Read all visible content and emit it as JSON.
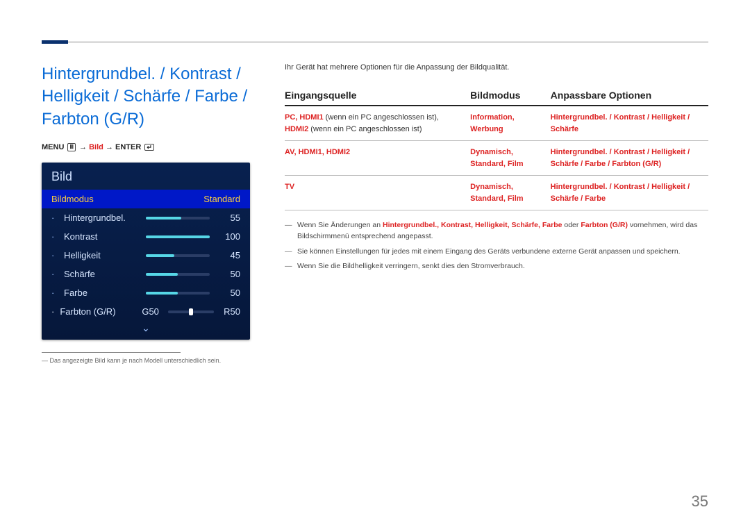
{
  "page_number": "35",
  "title": "Hintergrundbel. / Kontrast / Helligkeit / Schärfe / Farbe / Farbton (G/R)",
  "menupath": {
    "menu_label": "MENU",
    "arrow": "→",
    "mid": "Bild",
    "enter_label": "ENTER"
  },
  "osd": {
    "title": "Bild",
    "highlight": {
      "label": "Bildmodus",
      "value": "Standard"
    },
    "rows": [
      {
        "label": "Hintergrundbel.",
        "value": "55",
        "pct": 55
      },
      {
        "label": "Kontrast",
        "value": "100",
        "pct": 100
      },
      {
        "label": "Helligkeit",
        "value": "45",
        "pct": 45
      },
      {
        "label": "Schärfe",
        "value": "50",
        "pct": 50
      },
      {
        "label": "Farbe",
        "value": "50",
        "pct": 50
      }
    ],
    "gr": {
      "label": "Farbton (G/R)",
      "g": "G50",
      "r": "R50",
      "knob_pct": 50
    }
  },
  "footnote": "Das angezeigte Bild kann je nach Modell unterschiedlich sein.",
  "intro": "Ihr Gerät hat mehrere Optionen für die Anpassung der Bildqualität.",
  "table": {
    "headers": [
      "Eingangsquelle",
      "Bildmodus",
      "Anpassbare Optionen"
    ],
    "rows": [
      {
        "col1_bold": "PC, HDMI1",
        "col1_rest": " (wenn ein PC angeschlossen ist), ",
        "col1_bold2": "HDMI2",
        "col1_rest2": " (wenn ein PC angeschlossen ist)",
        "col2": "Information, Werbung",
        "col3": "Hintergrundbel. / Kontrast / Helligkeit / Schärfe"
      },
      {
        "col1_bold": "AV, HDMI1, HDMI2",
        "col1_rest": "",
        "col1_bold2": "",
        "col1_rest2": "",
        "col2": "Dynamisch, Standard, Film",
        "col3": "Hintergrundbel. / Kontrast / Helligkeit / Schärfe / Farbe / Farbton (G/R)"
      },
      {
        "col1_bold": "TV",
        "col1_rest": "",
        "col1_bold2": "",
        "col1_rest2": "",
        "col2": "Dynamisch, Standard, Film",
        "col3": "Hintergrundbel. / Kontrast / Helligkeit / Schärfe / Farbe"
      }
    ]
  },
  "notes": [
    {
      "pre": "Wenn Sie Änderungen an ",
      "bold": "Hintergrundbel., Kontrast, Helligkeit, Schärfe, Farbe",
      "mid": " oder ",
      "bold2": "Farbton (G/R)",
      "post": " vornehmen, wird das Bildschirmmenü entsprechend angepasst."
    },
    {
      "pre": "Sie können Einstellungen für jedes mit einem Eingang des Geräts verbundene externe Gerät anpassen und speichern.",
      "bold": "",
      "mid": "",
      "bold2": "",
      "post": ""
    },
    {
      "pre": "Wenn Sie die Bildhelligkeit verringern, senkt dies den Stromverbrauch.",
      "bold": "",
      "mid": "",
      "bold2": "",
      "post": ""
    }
  ]
}
